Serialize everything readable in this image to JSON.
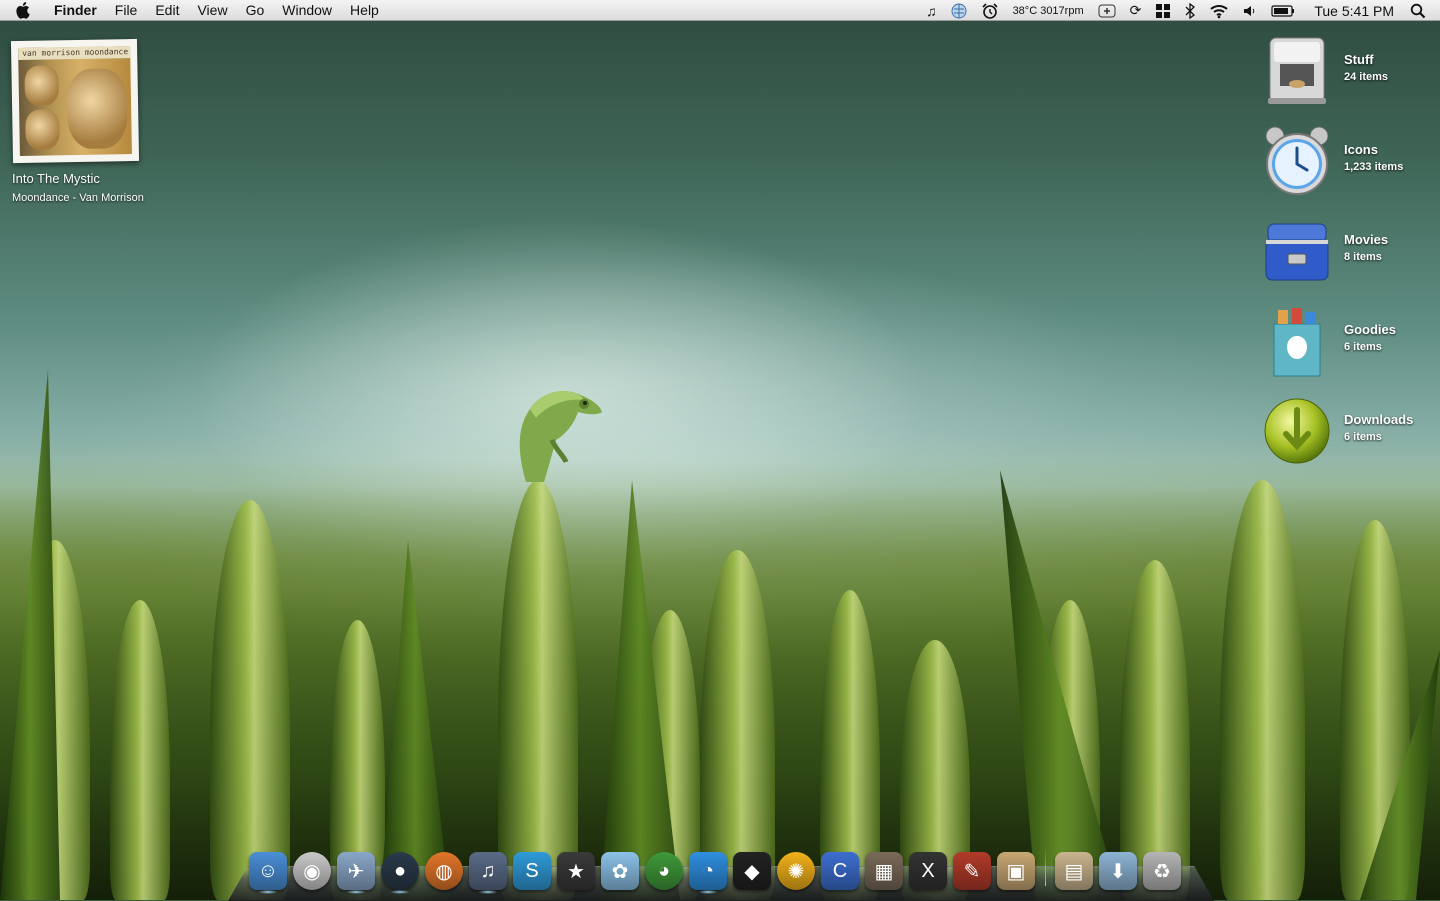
{
  "menubar": {
    "app_name": "Finder",
    "menus": [
      "File",
      "Edit",
      "View",
      "Go",
      "Window",
      "Help"
    ],
    "status": {
      "temp_fan": "38°C 3017rpm",
      "clock": "Tue 5:41 PM"
    },
    "status_icons": [
      "itunes-note-icon",
      "weather-globe-icon",
      "alarm-clock-icon",
      "add-icon",
      "sync-icon",
      "spaces-icon",
      "bluetooth-icon",
      "wifi-icon",
      "volume-icon",
      "battery-icon",
      "spotlight-icon"
    ]
  },
  "now_playing": {
    "cover_text": "van morrison moondance",
    "track": "Into The Mystic",
    "album_artist": "Moondance - Van Morrison"
  },
  "stacks": [
    {
      "name": "Stuff",
      "count": "24 items",
      "icon": "coffee-machine-icon"
    },
    {
      "name": "Icons",
      "count": "1,233 items",
      "icon": "alarm-clock-icon"
    },
    {
      "name": "Movies",
      "count": "8 items",
      "icon": "blue-case-icon"
    },
    {
      "name": "Goodies",
      "count": "6 items",
      "icon": "goodies-bag-icon"
    },
    {
      "name": "Downloads",
      "count": "6 items",
      "icon": "download-orb-icon"
    }
  ],
  "dock": {
    "apps": [
      {
        "name": "finder-icon",
        "glyph": "☺",
        "color": "#4a8fd6",
        "running": true
      },
      {
        "name": "dvd-player-icon",
        "glyph": "◉",
        "color": "#c9c9c9",
        "running": false
      },
      {
        "name": "mail-icon",
        "glyph": "✈",
        "color": "#8aa7c8",
        "running": true
      },
      {
        "name": "safari-globe-icon",
        "glyph": "●",
        "color": "#2a3a4a",
        "running": true
      },
      {
        "name": "firefox-icon",
        "glyph": "◍",
        "color": "#e2762a",
        "running": false
      },
      {
        "name": "itunes-icon",
        "glyph": "♫",
        "color": "#5a6b88",
        "running": true
      },
      {
        "name": "skype-icon",
        "glyph": "S",
        "color": "#2f9bd8",
        "running": false
      },
      {
        "name": "imovie-icon",
        "glyph": "★",
        "color": "#3a3a3a",
        "running": false
      },
      {
        "name": "iphoto-icon",
        "glyph": "✿",
        "color": "#8cc2e8",
        "running": false
      },
      {
        "name": "adium-icon",
        "glyph": "◕",
        "color": "#3f9a3a",
        "running": false
      },
      {
        "name": "ichat-icon",
        "glyph": "◔",
        "color": "#2f8fe0",
        "running": true
      },
      {
        "name": "front-row-icon",
        "glyph": "◆",
        "color": "#222222",
        "running": false
      },
      {
        "name": "flower-app-icon",
        "glyph": "✺",
        "color": "#f2b21a",
        "running": false
      },
      {
        "name": "candybar-icon",
        "glyph": "C",
        "color": "#3d6fd0",
        "running": false
      },
      {
        "name": "photo-browser-icon",
        "glyph": "▦",
        "color": "#7a6a58",
        "running": false
      },
      {
        "name": "x-app-icon",
        "glyph": "X",
        "color": "#333333",
        "running": false
      },
      {
        "name": "pencil-icon",
        "glyph": "✎",
        "color": "#b23b2a",
        "running": false
      },
      {
        "name": "preview-photo-icon",
        "glyph": "▣",
        "color": "#c8a874",
        "running": false
      }
    ],
    "stacks": [
      {
        "name": "goodies-stack-icon",
        "glyph": "▤",
        "color": "#c9b48e"
      },
      {
        "name": "downloads-stack-icon",
        "glyph": "⬇",
        "color": "#8db4d4"
      },
      {
        "name": "trash-icon",
        "glyph": "♻",
        "color": "#b5b5b5"
      }
    ]
  }
}
